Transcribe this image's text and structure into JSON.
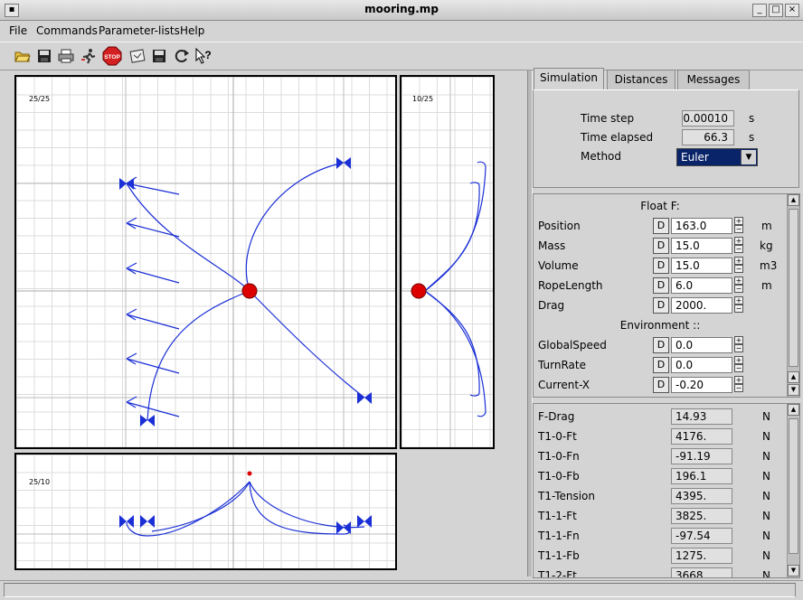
{
  "window": {
    "title": "mooring.mp"
  },
  "menu": [
    {
      "label": "File"
    },
    {
      "label": "Commands"
    },
    {
      "label": "Parameter-lists"
    },
    {
      "label": "Help"
    }
  ],
  "toolbar": [
    {
      "name": "open-icon",
      "glyph": "📂"
    },
    {
      "name": "save-icon",
      "glyph": "💾"
    },
    {
      "name": "print-icon",
      "glyph": "🖨"
    },
    {
      "name": "run-icon",
      "glyph": "🏃"
    },
    {
      "name": "stop-icon",
      "glyph": "STOP"
    },
    {
      "name": "settings-icon",
      "glyph": "⚙"
    },
    {
      "name": "save-as-icon",
      "glyph": "💾"
    },
    {
      "name": "reload-icon",
      "glyph": "⟳"
    },
    {
      "name": "help-pointer-icon",
      "glyph": "?"
    }
  ],
  "plots": {
    "top": {
      "label": "25/25"
    },
    "side": {
      "label": "10/25"
    },
    "bottom": {
      "label": "25/10"
    }
  },
  "tabs": [
    {
      "label": "Simulation",
      "active": true
    },
    {
      "label": "Distances",
      "active": false
    },
    {
      "label": "Messages",
      "active": false
    }
  ],
  "simulation": {
    "time_step_label": "Time step",
    "time_step_value": "0.00010",
    "time_step_unit": "s",
    "time_elapsed_label": "Time elapsed",
    "time_elapsed_value": "66.3",
    "time_elapsed_unit": "s",
    "method_label": "Method",
    "method_value": "Euler"
  },
  "params": {
    "float_header": "Float F:",
    "env_header": "Environment ::",
    "float_rows": [
      {
        "label": "Position",
        "d": "D",
        "value": "163.0",
        "unit": "m"
      },
      {
        "label": "Mass",
        "d": "D",
        "value": "15.0",
        "unit": "kg"
      },
      {
        "label": "Volume",
        "d": "D",
        "value": "15.0",
        "unit": "m3"
      },
      {
        "label": "RopeLength",
        "d": "D",
        "value": "6.0",
        "unit": "m"
      },
      {
        "label": "Drag",
        "d": "D",
        "value": "2000.",
        "unit": ""
      }
    ],
    "env_rows": [
      {
        "label": "GlobalSpeed",
        "d": "D",
        "value": "0.0",
        "unit": ""
      },
      {
        "label": "TurnRate",
        "d": "D",
        "value": "0.0",
        "unit": ""
      },
      {
        "label": "Current-X",
        "d": "D",
        "value": "-0.20",
        "unit": ""
      }
    ]
  },
  "results": [
    {
      "label": "F-Drag",
      "value": "14.93",
      "unit": "N"
    },
    {
      "label": "T1-0-Ft",
      "value": "4176.",
      "unit": "N"
    },
    {
      "label": "T1-0-Fn",
      "value": "-91.19",
      "unit": "N"
    },
    {
      "label": "T1-0-Fb",
      "value": "196.1",
      "unit": "N"
    },
    {
      "label": "T1-Tension",
      "value": "4395.",
      "unit": "N"
    },
    {
      "label": "T1-1-Ft",
      "value": "3825.",
      "unit": "N"
    },
    {
      "label": "T1-1-Fn",
      "value": "-97.54",
      "unit": "N"
    },
    {
      "label": "T1-1-Fb",
      "value": "1275.",
      "unit": "N"
    },
    {
      "label": "T1-2-Ft",
      "value": "3668.",
      "unit": "N"
    }
  ],
  "colors": {
    "rope": "#1a2fd6",
    "float": "#dd0000",
    "accent": "#0a246a"
  }
}
